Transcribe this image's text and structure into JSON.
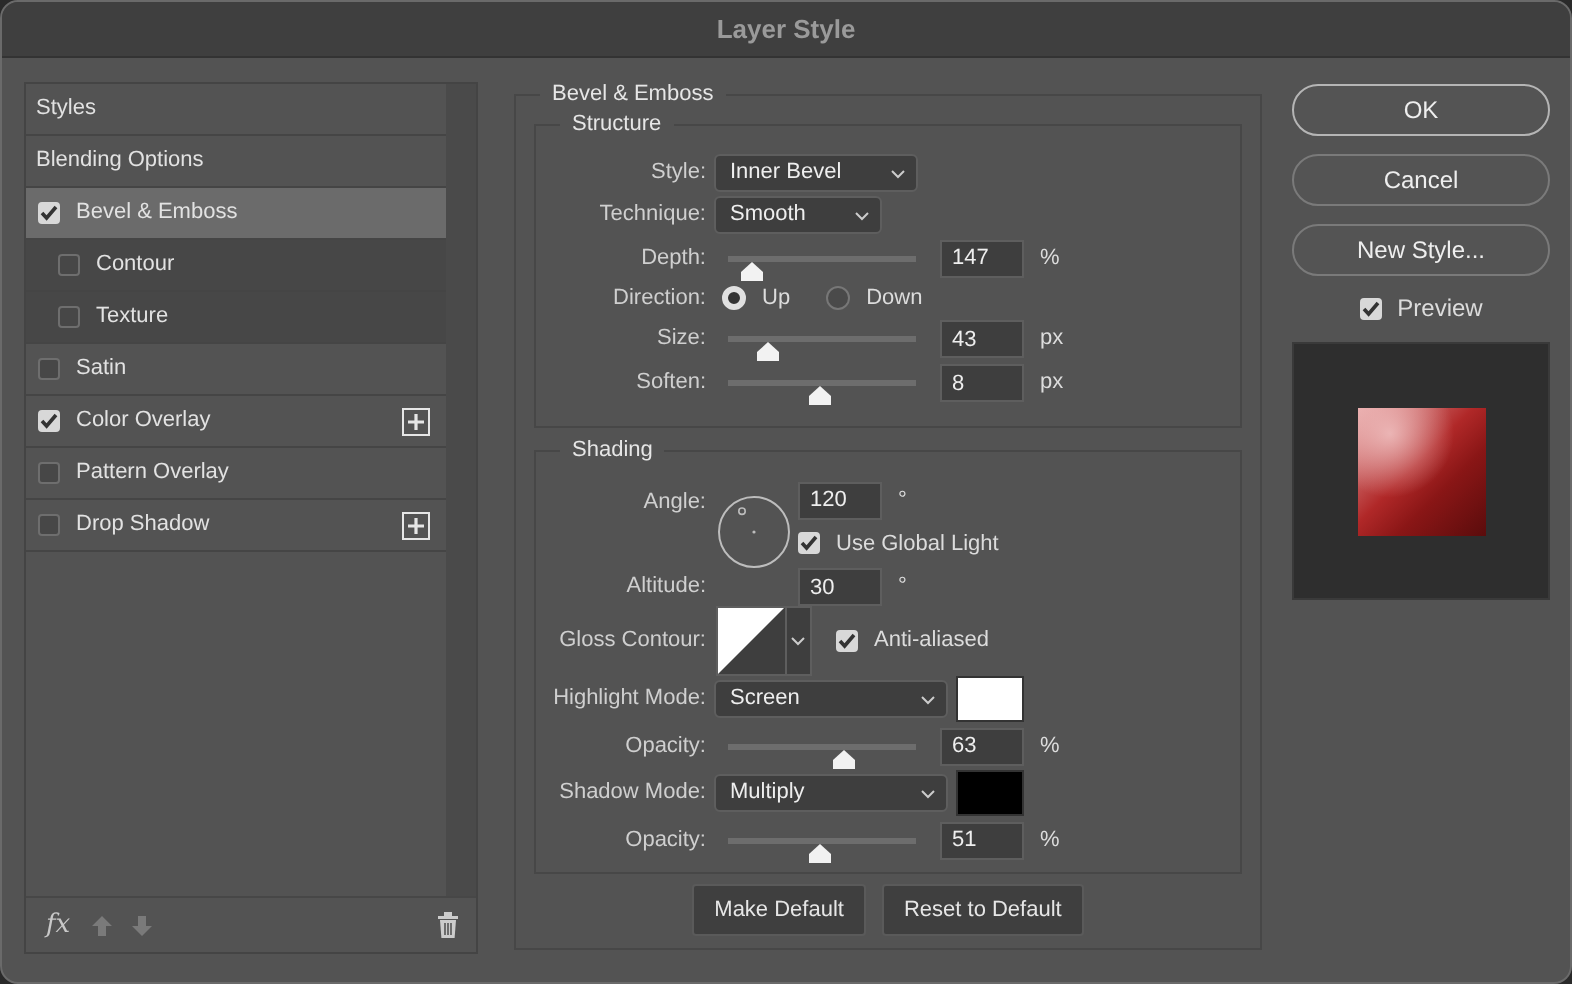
{
  "window": {
    "title": "Layer Style"
  },
  "styles_list": {
    "items": [
      {
        "kind": "header",
        "label": "Styles",
        "selected": false
      },
      {
        "kind": "header",
        "label": "Blending Options",
        "selected": false
      },
      {
        "kind": "effect",
        "label": "Bevel & Emboss",
        "checked": true,
        "selected": true,
        "add_button": false,
        "children": [
          {
            "kind": "effect",
            "label": "Contour",
            "checked": false,
            "selected": false,
            "add_button": false
          },
          {
            "kind": "effect",
            "label": "Texture",
            "checked": false,
            "selected": false,
            "add_button": false
          }
        ]
      },
      {
        "kind": "effect",
        "label": "Satin",
        "checked": false,
        "selected": false,
        "add_button": false
      },
      {
        "kind": "effect",
        "label": "Color Overlay",
        "checked": true,
        "selected": false,
        "add_button": true
      },
      {
        "kind": "effect",
        "label": "Pattern Overlay",
        "checked": false,
        "selected": false,
        "add_button": false
      },
      {
        "kind": "effect",
        "label": "Drop Shadow",
        "checked": false,
        "selected": false,
        "add_button": true
      }
    ],
    "toolbar": {
      "fx_label": "fx"
    }
  },
  "bevel_emboss": {
    "title": "Bevel & Emboss",
    "structure": {
      "title": "Structure",
      "rows": [
        {
          "kind": "select",
          "label": "Style:",
          "value": "Inner Bevel"
        },
        {
          "kind": "select",
          "label": "Technique:",
          "value": "Smooth"
        },
        {
          "kind": "slider",
          "label": "Depth:",
          "level": 0.13,
          "value": "147",
          "unit": "%"
        },
        {
          "kind": "radio",
          "label": "Direction:",
          "options": [
            {
              "label": "Up",
              "selected": true
            },
            {
              "label": "Down",
              "selected": false
            }
          ]
        },
        {
          "kind": "slider",
          "label": "Size:",
          "level": 0.21,
          "value": "43",
          "unit": "px"
        },
        {
          "kind": "slider",
          "label": "Soften:",
          "level": 0.49,
          "value": "8",
          "unit": "px"
        }
      ]
    },
    "shading": {
      "title": "Shading",
      "rows": [
        {
          "kind": "angle",
          "angle_label": "Angle:",
          "angle_value": "120",
          "angle_unit": "°",
          "altitude_label": "Altitude:",
          "altitude_value": "30",
          "altitude_unit": "°",
          "global_light": {
            "label": "Use Global Light",
            "checked": true
          }
        },
        {
          "kind": "contour",
          "label": "Gloss Contour:",
          "anti_aliased": {
            "label": "Anti-aliased",
            "checked": true
          }
        },
        {
          "kind": "select_color",
          "label": "Highlight Mode:",
          "value": "Screen",
          "color": "#ffffff"
        },
        {
          "kind": "slider",
          "label": "Opacity:",
          "level": 0.62,
          "value": "63",
          "unit": "%"
        },
        {
          "kind": "select_color",
          "label": "Shadow Mode:",
          "value": "Multiply",
          "color": "#000000"
        },
        {
          "kind": "slider",
          "label": "Opacity:",
          "level": 0.49,
          "value": "51",
          "unit": "%"
        }
      ]
    },
    "buttons": [
      "Make Default",
      "Reset to Default"
    ]
  },
  "side": {
    "buttons": [
      {
        "label": "OK",
        "default": true
      },
      {
        "label": "Cancel",
        "default": false
      },
      {
        "label": "New Style...",
        "default": false
      }
    ],
    "preview": {
      "label": "Preview",
      "checked": true
    }
  }
}
